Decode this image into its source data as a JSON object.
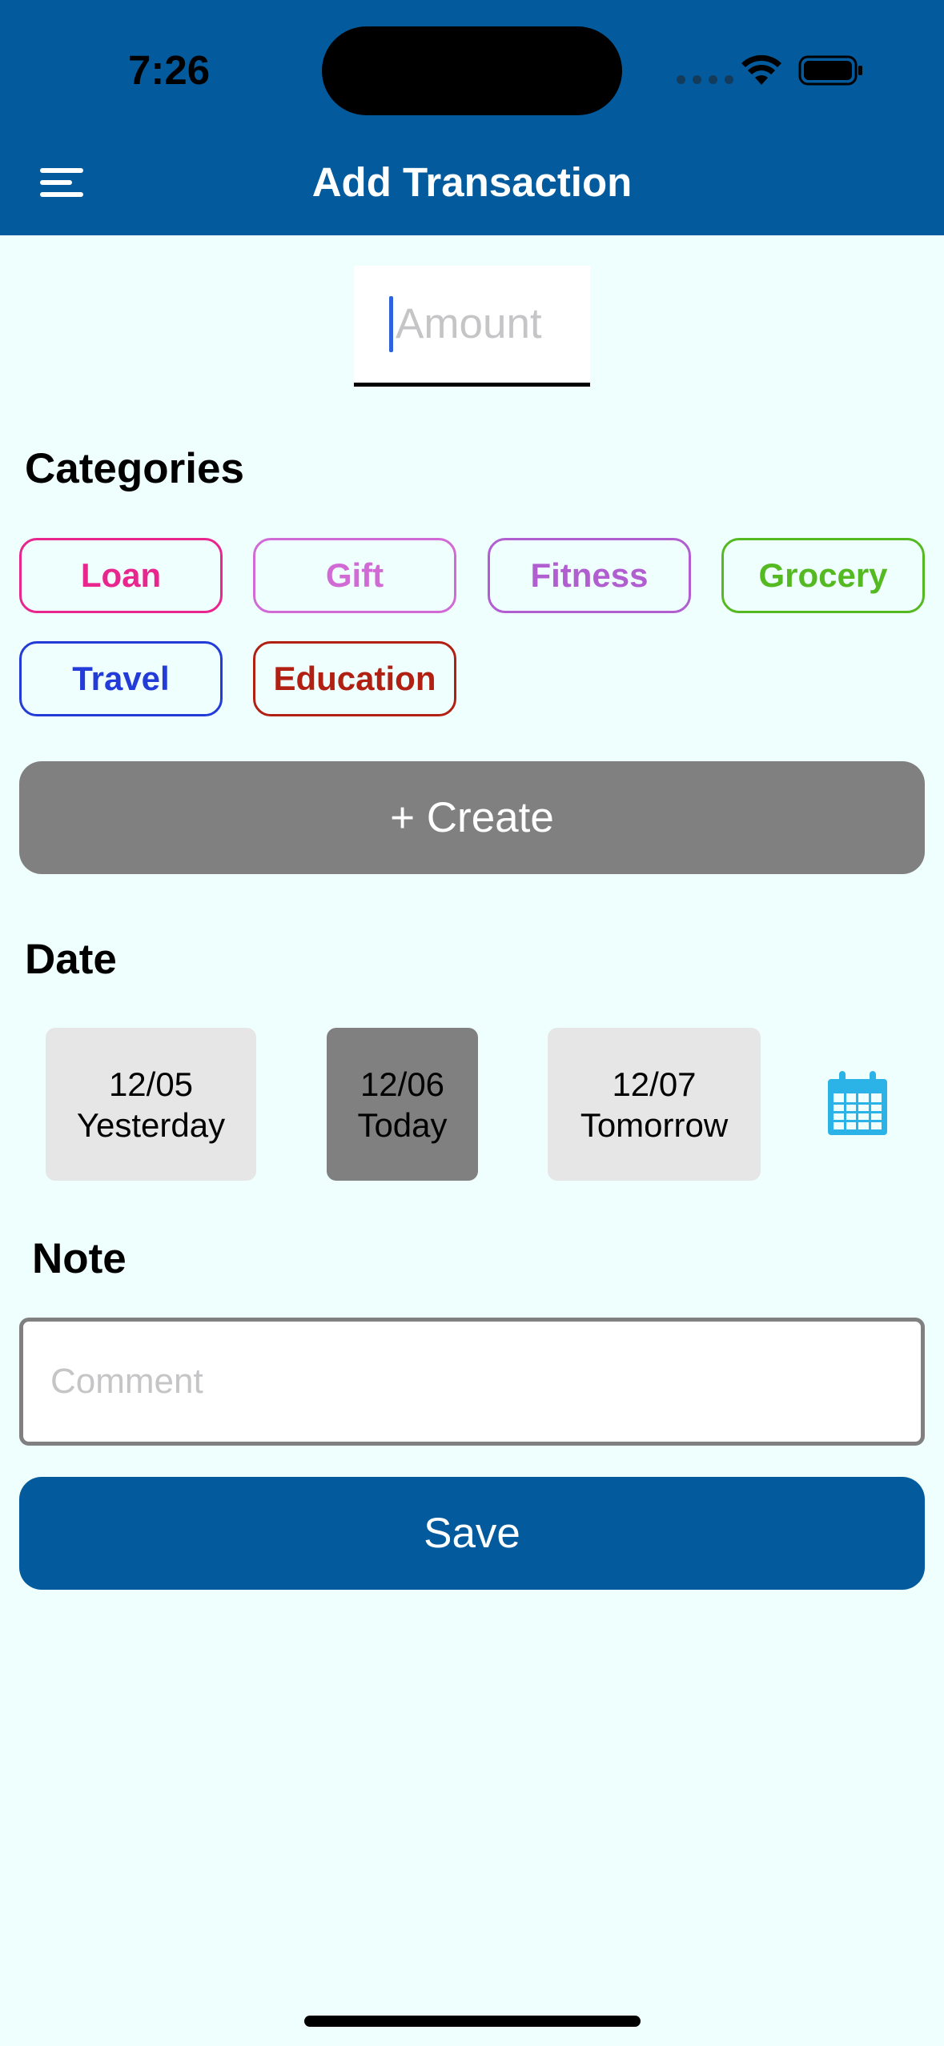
{
  "status_bar": {
    "time": "7:26"
  },
  "header": {
    "title": "Add Transaction",
    "menu_icon": "hamburger-menu-icon",
    "background": "#035a9d"
  },
  "amount": {
    "placeholder": "Amount",
    "value": ""
  },
  "categories": {
    "title": "Categories",
    "items": [
      {
        "label": "Loan",
        "color": "#e8268e"
      },
      {
        "label": "Gift",
        "color": "#d26ad5"
      },
      {
        "label": "Fitness",
        "color": "#b15fd0"
      },
      {
        "label": "Grocery",
        "color": "#55b922"
      },
      {
        "label": "Travel",
        "color": "#233bd8"
      },
      {
        "label": "Education",
        "color": "#b12012"
      }
    ],
    "create_label": "+ Create"
  },
  "date": {
    "title": "Date",
    "options": [
      {
        "date": "12/05",
        "label": "Yesterday",
        "selected": false
      },
      {
        "date": "12/06",
        "label": "Today",
        "selected": true
      },
      {
        "date": "12/07",
        "label": "Tomorrow",
        "selected": false
      }
    ],
    "calendar_icon": "calendar-icon"
  },
  "note": {
    "title": "Note",
    "placeholder": "Comment",
    "value": ""
  },
  "save_label": "Save",
  "colors": {
    "background": "#effffe",
    "accent": "#035a9d",
    "create_button": "#808080",
    "date_card": "#e6e6e6",
    "date_card_selected": "#808080",
    "calendar_icon": "#2bb3e8"
  }
}
